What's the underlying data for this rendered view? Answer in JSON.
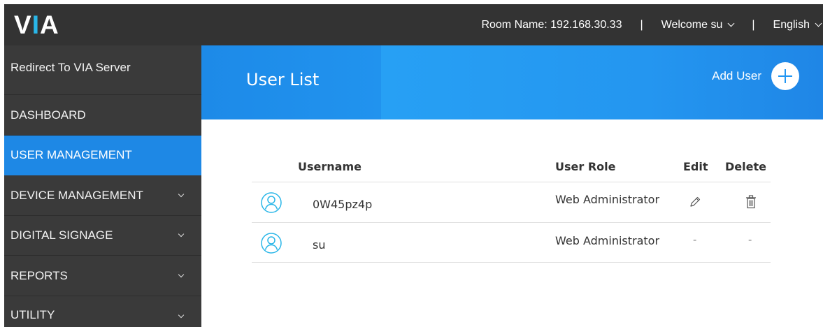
{
  "header": {
    "logo": {
      "v": "V",
      "i": "I",
      "a": "A"
    },
    "room_name": "Room Name: 192.168.30.33",
    "separator": "|",
    "welcome": "Welcome su",
    "language": "English"
  },
  "sidebar": {
    "redirect": "Redirect To VIA Server",
    "items": [
      {
        "label": "DASHBOARD",
        "expandable": false,
        "active": false
      },
      {
        "label": "USER MANAGEMENT",
        "expandable": false,
        "active": true
      },
      {
        "label": "DEVICE MANAGEMENT",
        "expandable": true,
        "active": false
      },
      {
        "label": "DIGITAL SIGNAGE",
        "expandable": true,
        "active": false
      },
      {
        "label": "REPORTS",
        "expandable": true,
        "active": false
      },
      {
        "label": "UTILITY",
        "expandable": true,
        "active": false
      }
    ]
  },
  "page": {
    "title": "User List",
    "add_user": "Add User"
  },
  "table": {
    "columns": {
      "username": "Username",
      "role": "User Role",
      "edit": "Edit",
      "delete": "Delete"
    },
    "rows": [
      {
        "username": "0W45pz4p",
        "role": "Web Administrator",
        "edit": "edit",
        "delete": "delete"
      },
      {
        "username": "su",
        "role": "Web Administrator",
        "edit": "-",
        "delete": "-"
      }
    ]
  },
  "colors": {
    "topbar": "#333333",
    "sidebar": "#3a3a3a",
    "accent": "#1e88e5",
    "logo_highlight": "#29b6e8",
    "avatar": "#29b6e8"
  },
  "icons": {
    "avatar": "user-circle-icon",
    "edit": "pencil-icon",
    "delete": "trash-icon",
    "add": "plus-circle-icon",
    "dropdown": "chevron-down-icon"
  }
}
